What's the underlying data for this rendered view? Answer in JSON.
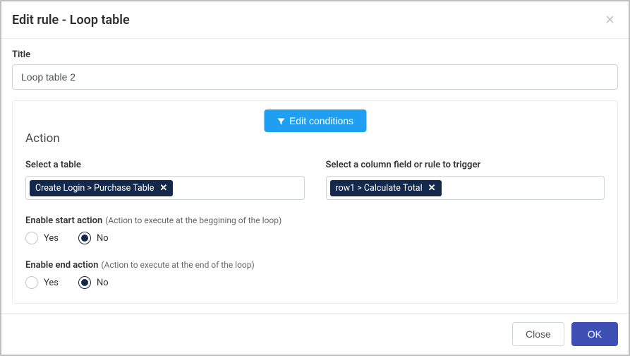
{
  "header": {
    "title": "Edit rule - Loop table"
  },
  "title_field": {
    "label": "Title",
    "value": "Loop table 2"
  },
  "panel": {
    "edit_conditions_label": "Edit conditions",
    "heading": "Action",
    "table_select": {
      "label": "Select a table",
      "token": "Create Login > Purchase Table"
    },
    "trigger_select": {
      "label": "Select a column field or rule to trigger",
      "token": "row1 > Calculate Total"
    },
    "start_action": {
      "label": "Enable start action",
      "hint": "(Action to execute at the beggining of the loop)",
      "yes": "Yes",
      "no": "No",
      "selected": "no"
    },
    "end_action": {
      "label": "Enable end action",
      "hint": "(Action to execute at the end of the loop)",
      "yes": "Yes",
      "no": "No",
      "selected": "no"
    }
  },
  "footer": {
    "close": "Close",
    "ok": "OK"
  }
}
